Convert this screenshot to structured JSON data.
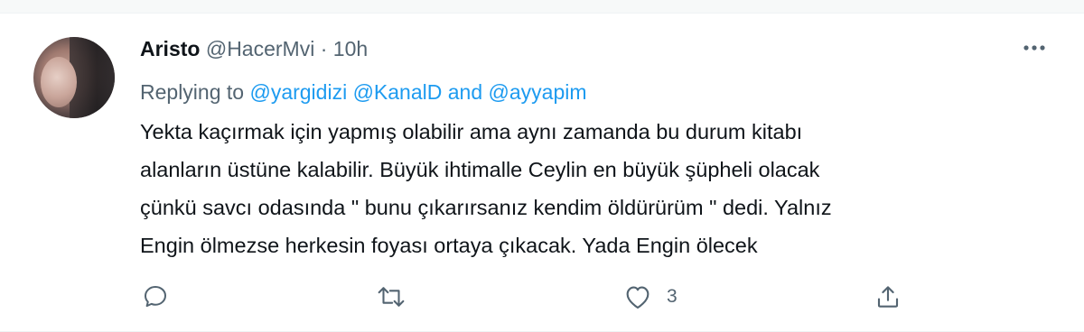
{
  "tweet": {
    "author_name": "Aristo",
    "author_handle": "@HacerMvi",
    "separator": "·",
    "time": "10h",
    "replying_prefix": "Replying to",
    "reply_to_1": "@yargidizi",
    "reply_to_2": "@KanalD",
    "reply_and": "and",
    "reply_to_3": "@ayyapim",
    "text_lines": [
      "Yekta kaçırmak için yapmış olabilir ama aynı zamanda bu durum kitabı",
      "alanların üstüne kalabilir. Büyük ihtimalle Ceylin en büyük şüpheli olacak",
      "çünkü savcı odasında \" bunu çıkarırsanız kendim öldürürüm \" dedi. Yalnız",
      "Engin ölmezse herkesin foyası ortaya çıkacak. Yada Engin ölecek"
    ],
    "like_count": "3"
  },
  "icons": {
    "more": "more-horizontal-icon",
    "reply": "reply-bubble-icon",
    "retweet": "retweet-icon",
    "like": "heart-icon",
    "share": "share-upload-icon"
  },
  "colors": {
    "text": "#0f1419",
    "secondary": "#536471",
    "link": "#1d9bf0"
  }
}
